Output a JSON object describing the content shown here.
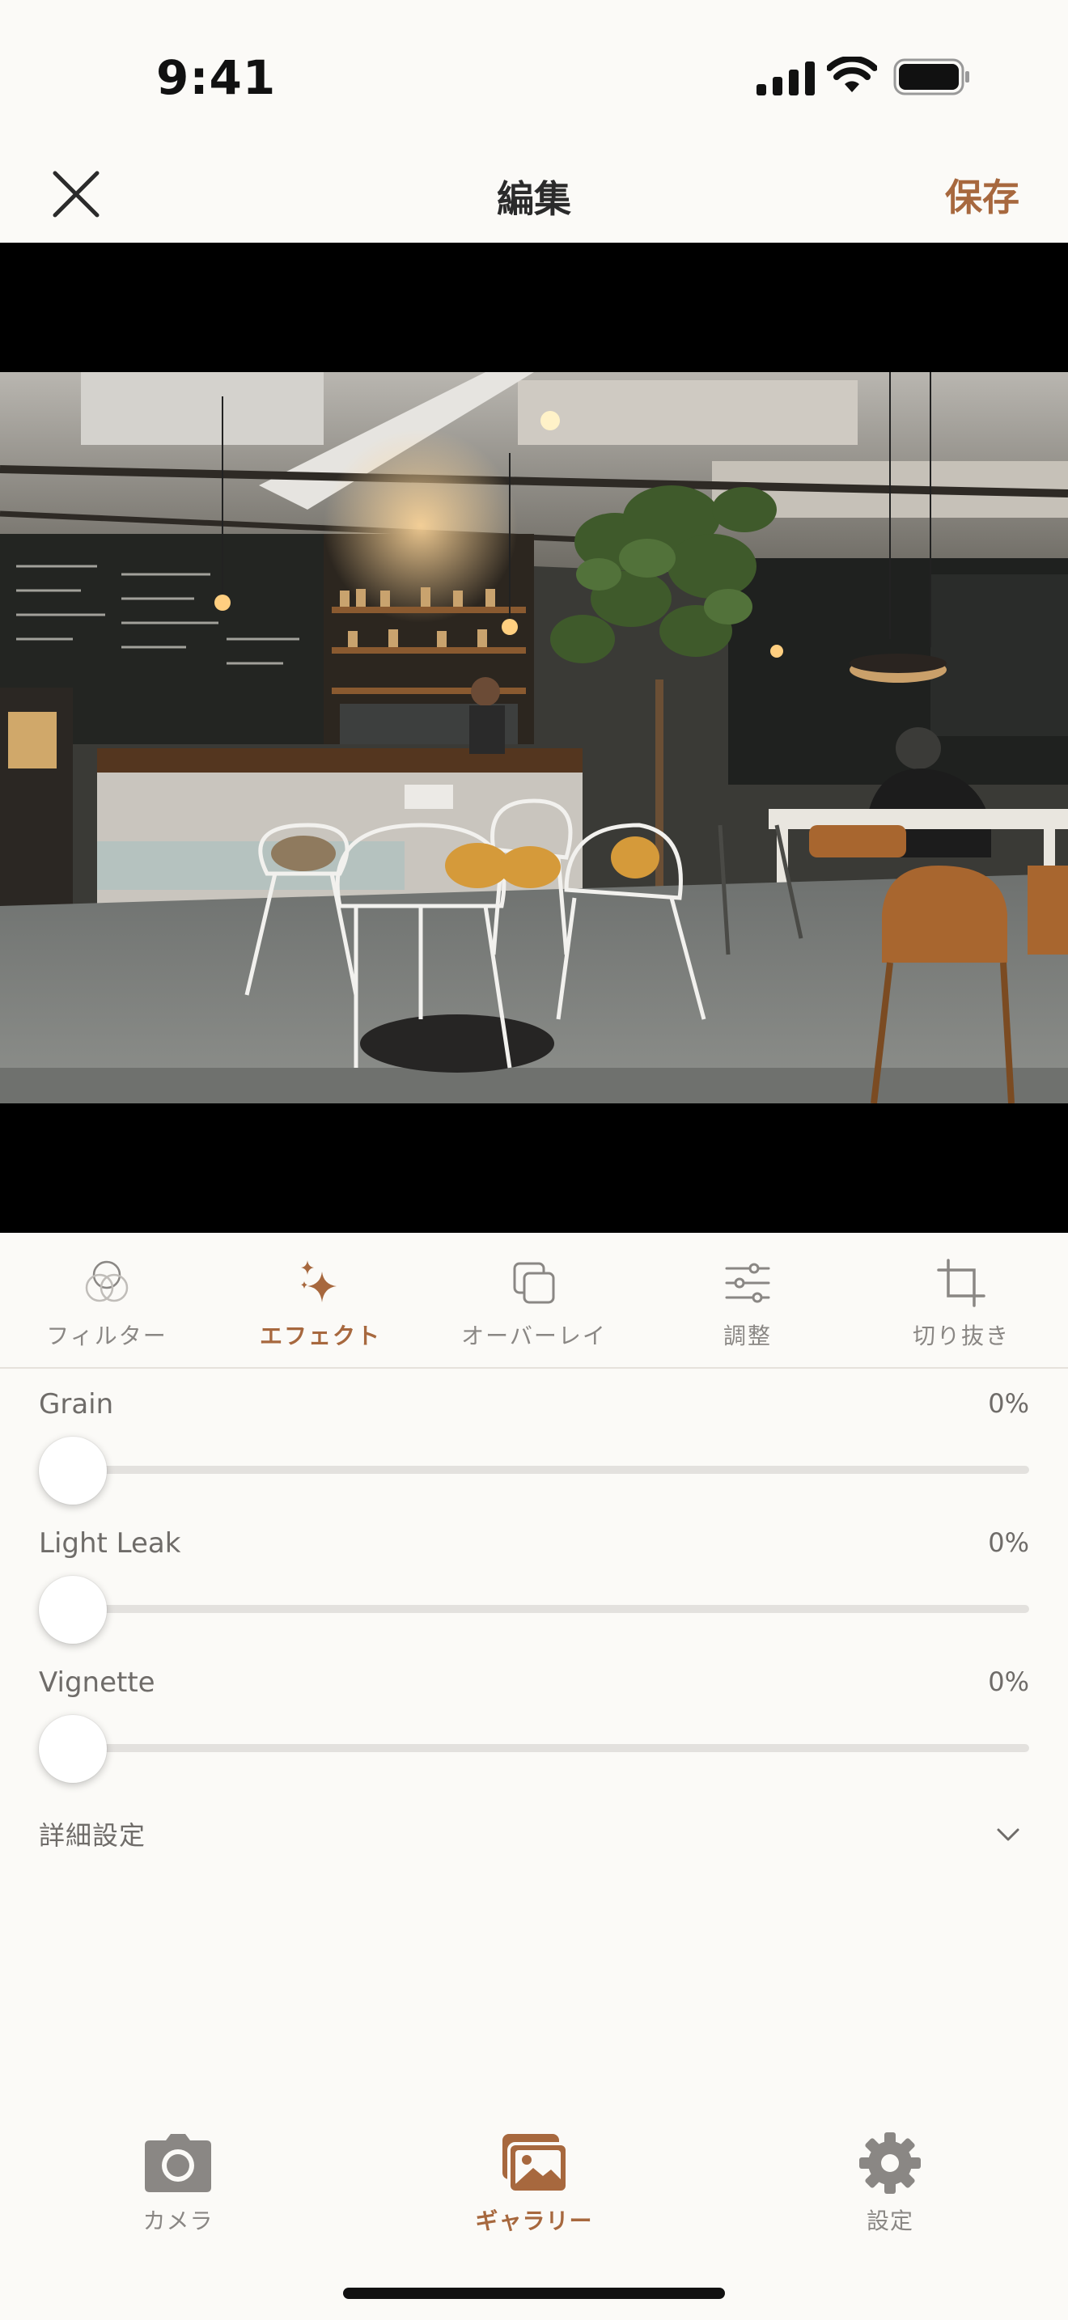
{
  "status_bar": {
    "time": "9:41"
  },
  "nav": {
    "title": "編集",
    "save_label": "保存",
    "close_icon": "close-icon"
  },
  "tools": [
    {
      "label": "フィルター",
      "icon": "filter-circles-icon",
      "active": false
    },
    {
      "label": "エフェクト",
      "icon": "sparkle-icon",
      "active": true
    },
    {
      "label": "オーバーレイ",
      "icon": "overlay-squares-icon",
      "active": false
    },
    {
      "label": "調整",
      "icon": "sliders-icon",
      "active": false
    },
    {
      "label": "切り抜き",
      "icon": "crop-icon",
      "active": false
    }
  ],
  "effects": [
    {
      "name": "Grain",
      "value_text": "0%",
      "value": 0
    },
    {
      "name": "Light Leak",
      "value_text": "0%",
      "value": 0
    },
    {
      "name": "Vignette",
      "value_text": "0%",
      "value": 0
    }
  ],
  "advanced": {
    "label": "詳細設定",
    "icon": "chevron-down-icon"
  },
  "tab_bar": [
    {
      "label": "カメラ",
      "icon": "camera-icon",
      "active": false
    },
    {
      "label": "ギャラリー",
      "icon": "gallery-icon",
      "active": true
    },
    {
      "label": "設定",
      "icon": "gear-icon",
      "active": false
    }
  ],
  "colors": {
    "accent": "#a7683e",
    "inactive": "#8a8784",
    "background": "#fbfaf7"
  }
}
